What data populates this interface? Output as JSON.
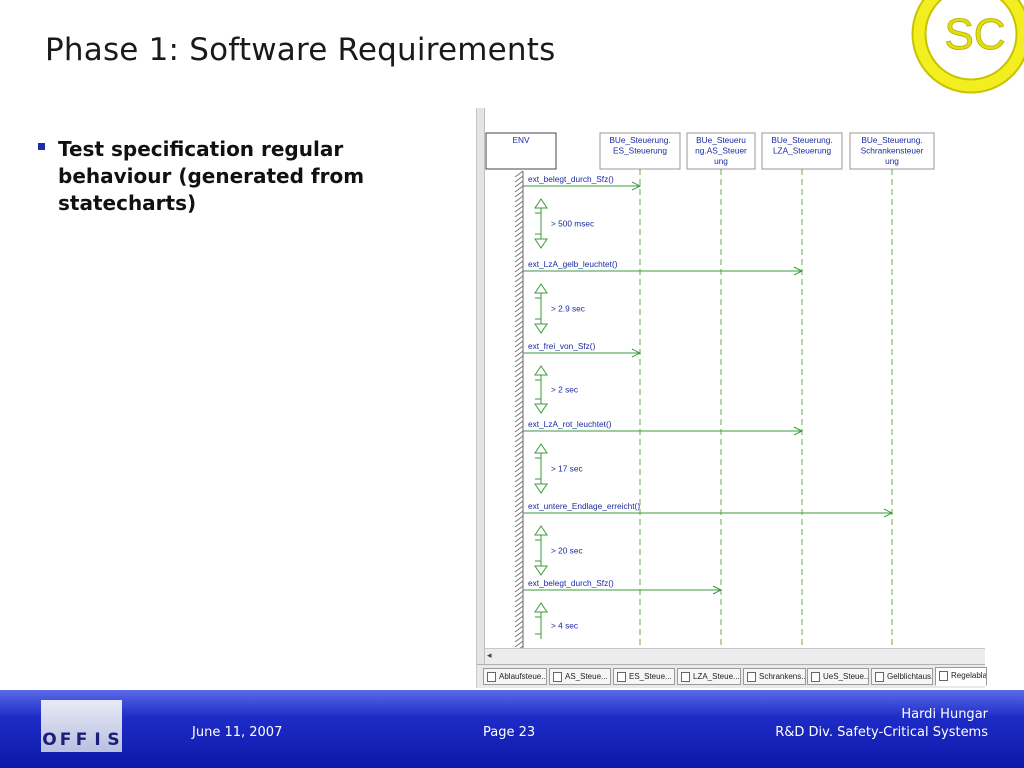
{
  "slide": {
    "title": "Phase 1: Software Requirements",
    "bullet": "Test specification regular behaviour (generated from statecharts)",
    "logo_text": "SC"
  },
  "diagram": {
    "lifelines": [
      {
        "label_lines": [
          "ENV"
        ]
      },
      {
        "label_lines": [
          "BUe_Steuerung.",
          "ES_Steuerung"
        ]
      },
      {
        "label_lines": [
          "BUe_Steueru",
          "ng.AS_Steuer",
          "ung"
        ]
      },
      {
        "label_lines": [
          "BUe_Steuerung.",
          "LZA_Steuerung"
        ]
      },
      {
        "label_lines": [
          "BUe_Steuerung.",
          "Schrankensteuer",
          "ung"
        ]
      }
    ],
    "messages": [
      {
        "label": "ext_belegt_durch_Sfz()",
        "target": 1
      },
      {
        "label": "ext_LzA_gelb_leuchtet()",
        "target": 3
      },
      {
        "label": "ext_frei_von_Sfz()",
        "target": 1
      },
      {
        "label": "ext_LzA_rot_leuchtet()",
        "target": 3
      },
      {
        "label": "ext_untere_Endlage_erreicht()",
        "target": 4
      },
      {
        "label": "ext_belegt_durch_Sfz()",
        "target": 2
      }
    ],
    "timeouts": [
      "> 500 msec",
      "> 2.9 sec",
      "> 2 sec",
      "> 17 sec",
      "> 20 sec",
      "> 4 sec"
    ],
    "tabs": [
      "Ablaufsteue...",
      "AS_Steue...",
      "ES_Steue...",
      "LZA_Steue...",
      "Schrankens...",
      "UeS_Steue...",
      "Gelblichtaus...",
      "Regelablauf"
    ],
    "scroll_arrow": "◂"
  },
  "footer": {
    "date": "June 11, 2007",
    "page": "Page 23",
    "author": "Hardi Hungar",
    "division": "R&D Div. Safety-Critical Systems",
    "logo_letters": [
      "O",
      "F",
      "F",
      "I",
      "S"
    ]
  },
  "colors": {
    "accent_blue": "#1d2cc7",
    "logo_yellow": "#f2ee1f",
    "message_green": "#3b9b3b",
    "lifeline_green": "#6aa84f",
    "text_blue": "#1a2aa0"
  }
}
